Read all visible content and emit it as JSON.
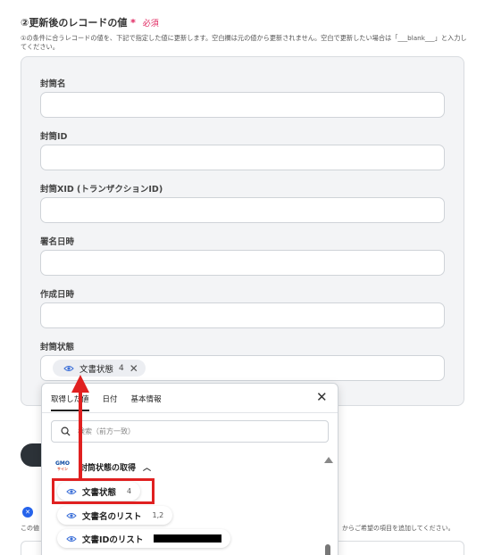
{
  "section": {
    "title": "②更新後のレコードの値",
    "required_star": "*",
    "required_label": "必須",
    "description": "①の条件に合うレコードの値を、下記で指定した値に更新します。空白欄は元の値から更新されません。空白で更新したい場合は「___blank___」と入力してください。"
  },
  "fields": [
    {
      "label": "封筒名",
      "value": ""
    },
    {
      "label": "封筒ID",
      "value": ""
    },
    {
      "label": "封筒XID (トランザクションID)",
      "value": ""
    },
    {
      "label": "署名日時",
      "value": ""
    },
    {
      "label": "作成日時",
      "value": ""
    },
    {
      "label": "封筒状態",
      "value": ""
    }
  ],
  "selected_tag": {
    "label": "文書状態",
    "count": "4",
    "icon": "eye-icon"
  },
  "dropdown": {
    "tabs": [
      "取得した値",
      "日付",
      "基本情報"
    ],
    "active_tab": "取得した値",
    "search_placeholder": "検索（前方一致）",
    "group": {
      "logo_top": "GMO",
      "logo_bottom": "サイン",
      "title": "封筒状態の取得"
    },
    "options": [
      {
        "label": "文書状態",
        "value": "4"
      },
      {
        "label": "文書名のリスト",
        "value": "1,2"
      },
      {
        "label": "文書IDのリスト",
        "value": ""
      }
    ]
  },
  "bottom": {
    "left_text": "この値",
    "right_text": "からご希望の項目を追加してください。"
  },
  "colors": {
    "highlight": "#e02020",
    "required": "#e0245e",
    "info_badge": "#2563eb"
  }
}
